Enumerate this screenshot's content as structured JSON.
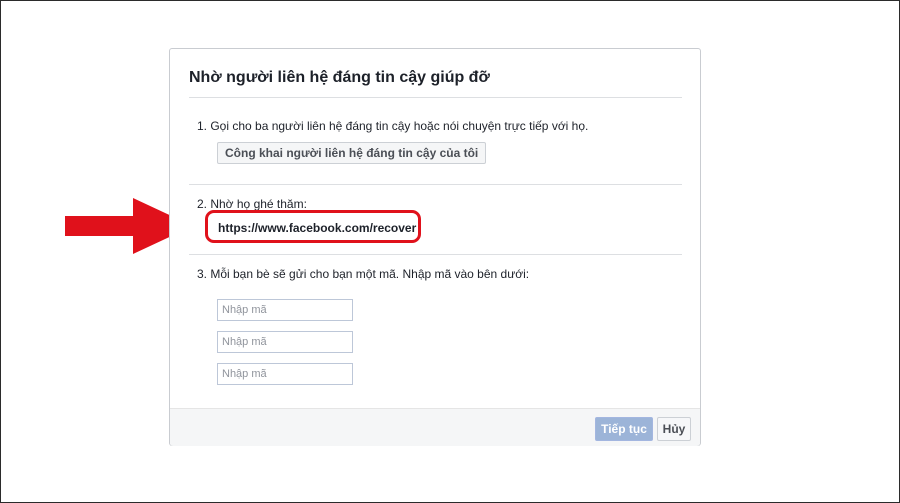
{
  "dialog": {
    "title": "Nhờ người liên hệ đáng tin cậy giúp đỡ",
    "step1": {
      "text": "1. Gọi cho ba người liên hệ đáng tin cậy hoặc nói chuyện trực tiếp với họ.",
      "button_label": "Công khai người liên hệ đáng tin cậy của tôi"
    },
    "step2": {
      "text": "2. Nhờ họ ghé thăm:",
      "link": "https://www.facebook.com/recover"
    },
    "step3": {
      "text": "3. Mỗi bạn bè sẽ gửi cho bạn một mã. Nhập mã vào bên dưới:",
      "inputs": [
        {
          "placeholder": "Nhập mã",
          "value": ""
        },
        {
          "placeholder": "Nhập mã",
          "value": ""
        },
        {
          "placeholder": "Nhập mã",
          "value": ""
        }
      ]
    },
    "footer": {
      "continue_label": "Tiếp tục",
      "cancel_label": "Hủy"
    }
  },
  "colors": {
    "highlight_red": "#e0111b",
    "primary_disabled": "#9cb4d8",
    "text": "#1d2129"
  },
  "annotation": {
    "arrow_icon": "right-arrow-icon"
  }
}
